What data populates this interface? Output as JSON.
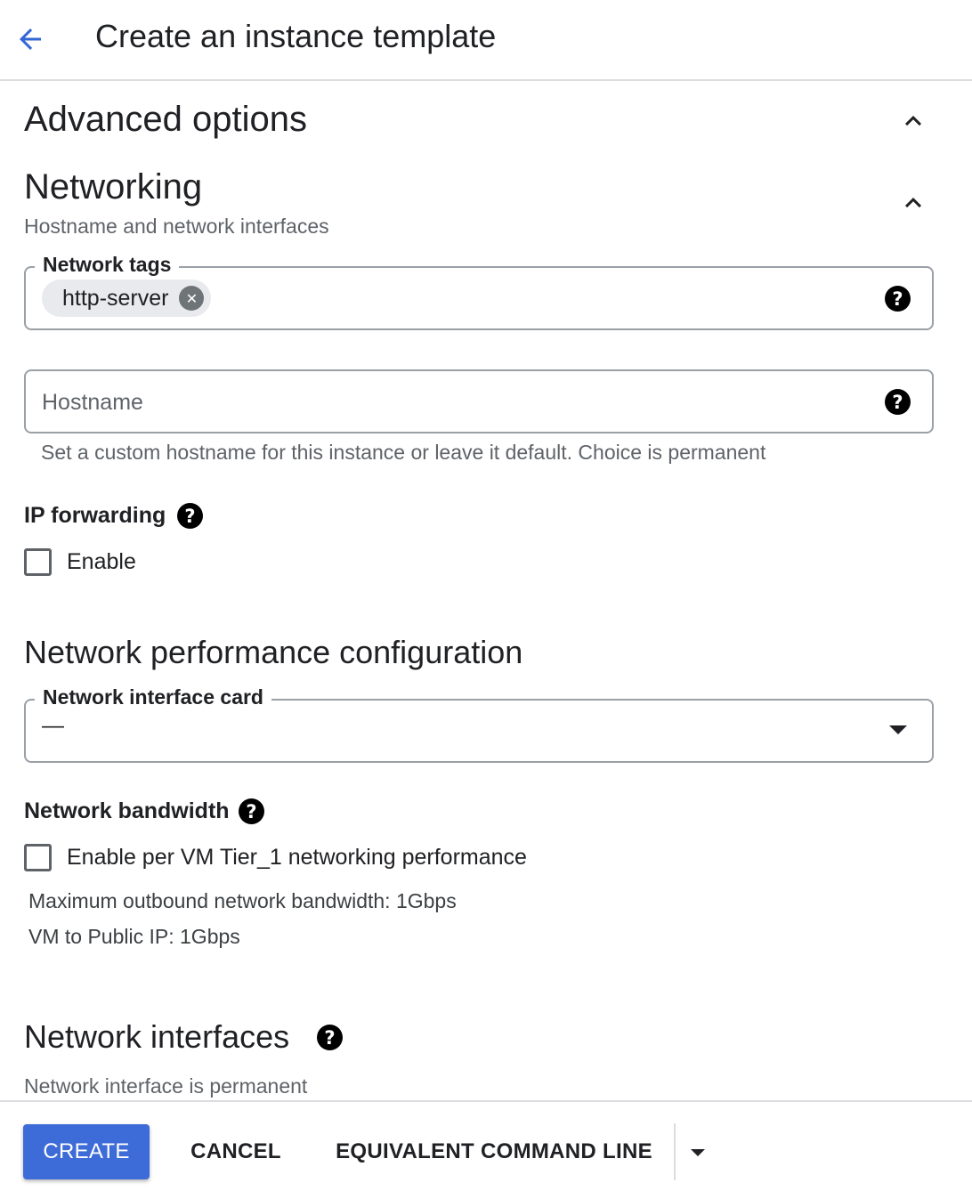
{
  "header": {
    "title": "Create an instance template",
    "back_icon": "arrow-back-icon"
  },
  "advanced": {
    "title": "Advanced options"
  },
  "networking": {
    "title": "Networking",
    "subtitle": "Hostname and network interfaces",
    "network_tags": {
      "label": "Network tags",
      "chips": [
        "http-server"
      ]
    },
    "hostname": {
      "placeholder": "Hostname",
      "value": "",
      "hint": "Set a custom hostname for this instance or leave it default. Choice is permanent"
    },
    "ip_forwarding": {
      "label": "IP forwarding",
      "checkbox_label": "Enable",
      "checked": false
    },
    "performance": {
      "title": "Network performance configuration",
      "nic": {
        "label": "Network interface card",
        "value": "—"
      },
      "bandwidth": {
        "label": "Network bandwidth",
        "checkbox_label": "Enable per VM Tier_1 networking performance",
        "checked": false,
        "max_outbound": "Maximum outbound network bandwidth: 1Gbps",
        "public_ip": "VM to Public IP: 1Gbps"
      }
    },
    "interfaces": {
      "title": "Network interfaces",
      "subtitle": "Network interface is permanent"
    }
  },
  "footer": {
    "create_label": "CREATE",
    "cancel_label": "CANCEL",
    "command_line_label": "EQUIVALENT COMMAND LINE"
  },
  "help_glyph": "?",
  "colors": {
    "primary": "#3d6bd8",
    "back_arrow": "#3367d6",
    "border": "#9aa0a6"
  }
}
